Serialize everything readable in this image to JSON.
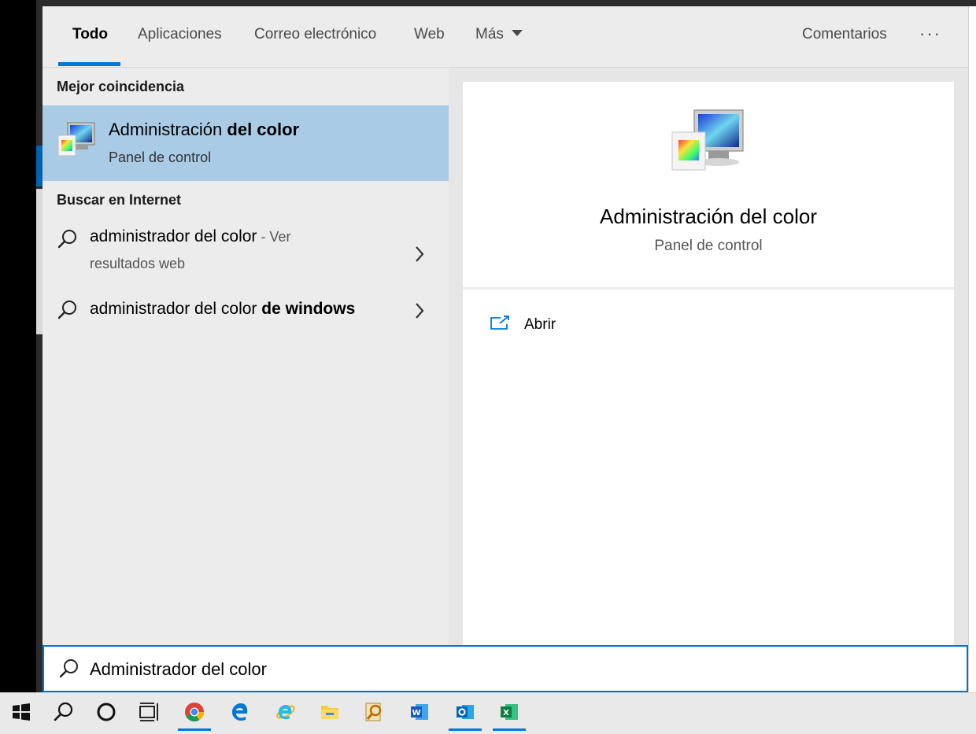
{
  "tabs": {
    "items": [
      {
        "label": "Todo",
        "active": true
      },
      {
        "label": "Aplicaciones"
      },
      {
        "label": "Correo electrónico"
      },
      {
        "label": "Web"
      },
      {
        "label": "Más"
      }
    ],
    "feedback_label": "Comentarios",
    "more_label": "···"
  },
  "left": {
    "best_match_header": "Mejor coincidencia",
    "best_match": {
      "title_normal": "Administración ",
      "title_bold": "del color",
      "subtitle": "Panel de control",
      "icon": "color-management-icon"
    },
    "web_header": "Buscar en Internet",
    "web_results": [
      {
        "text": "administrador del color",
        "suffix": " - Ver",
        "line2": "resultados web"
      },
      {
        "text": "administrador del color ",
        "bold": "de windows"
      }
    ]
  },
  "detail": {
    "title": "Administración del color",
    "subtitle": "Panel de control",
    "actions": [
      {
        "label": "Abrir",
        "icon": "open-window-icon"
      }
    ]
  },
  "search": {
    "value": "Administrador del color"
  },
  "taskbar": {
    "items": [
      "start-icon",
      "search-icon",
      "cortana-icon",
      "task-view-icon",
      "chrome-icon",
      "edge-icon",
      "internet-explorer-icon",
      "file-explorer-icon",
      "search-app-icon",
      "word-icon",
      "outlook-icon",
      "excel-icon"
    ]
  },
  "colors": {
    "accent": "#0078d7",
    "selection": "#aacbe6"
  }
}
